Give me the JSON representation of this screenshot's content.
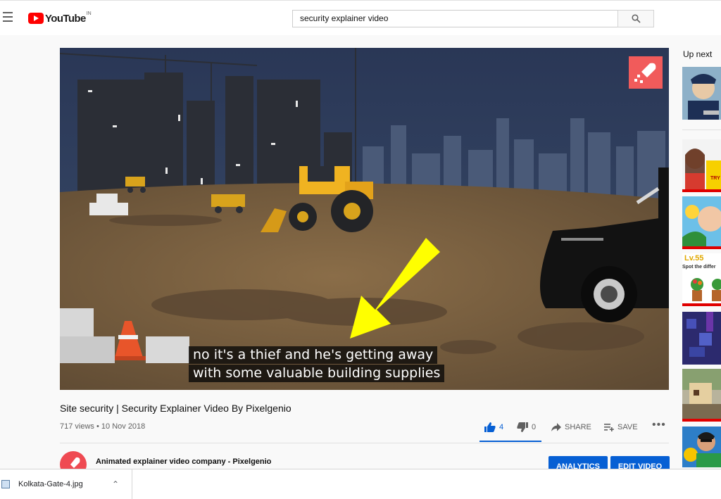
{
  "masthead": {
    "logo_text": "YouTube",
    "country_code": "IN",
    "search_value": "security explainer video"
  },
  "player": {
    "caption_line1": "no it's a thief and he's getting away",
    "caption_line2": "with some valuable building supplies"
  },
  "video": {
    "title": "Site security | Security Explainer Video By Pixelgenio",
    "views": "717 views",
    "date": "10 Nov 2018",
    "like_count": "4",
    "dislike_count": "0",
    "share_label": "SHARE",
    "save_label": "SAVE"
  },
  "channel": {
    "name": "Animated explainer video company - Pixelgenio",
    "analytics_label": "ANALYTICS",
    "edit_label": "EDIT VIDEO"
  },
  "sidebar": {
    "up_next_label": "Up next",
    "thumb_text_level": "Lv.55",
    "thumb_text_spot": "Spot the differ",
    "thumb_text_try": "TRY"
  },
  "download_bar": {
    "file_name": "Kolkata-Gate-4.jpg"
  },
  "colors": {
    "brand_red": "#ff0000",
    "accent_blue": "#065fd4",
    "annotation_yellow": "#ffff00"
  }
}
